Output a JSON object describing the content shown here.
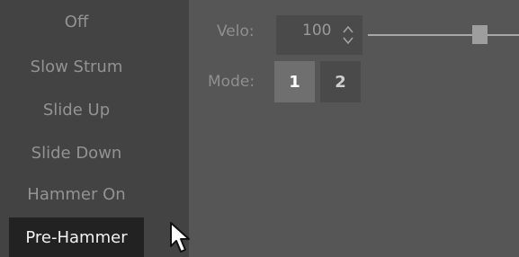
{
  "sidebar": {
    "items": [
      {
        "label": "Off"
      },
      {
        "label": "Slow Strum"
      },
      {
        "label": "Slide Up"
      },
      {
        "label": "Slide Down"
      },
      {
        "label": "Hammer On"
      },
      {
        "label": "Pre-Hammer",
        "selected": true
      }
    ]
  },
  "controls": {
    "velo_label": "Velo:",
    "velo_value": "100",
    "mode_label": "Mode:",
    "mode_options": [
      "1",
      "2"
    ],
    "mode_selected": "1"
  },
  "icons": {
    "spinner": "up-down-arrows-icon",
    "cursor": "mouse-pointer-icon"
  },
  "colors": {
    "sidebar_bg": "#434343",
    "panel_bg": "#565656",
    "selected_bg": "#222222",
    "active_button": "#6f6f6f"
  }
}
